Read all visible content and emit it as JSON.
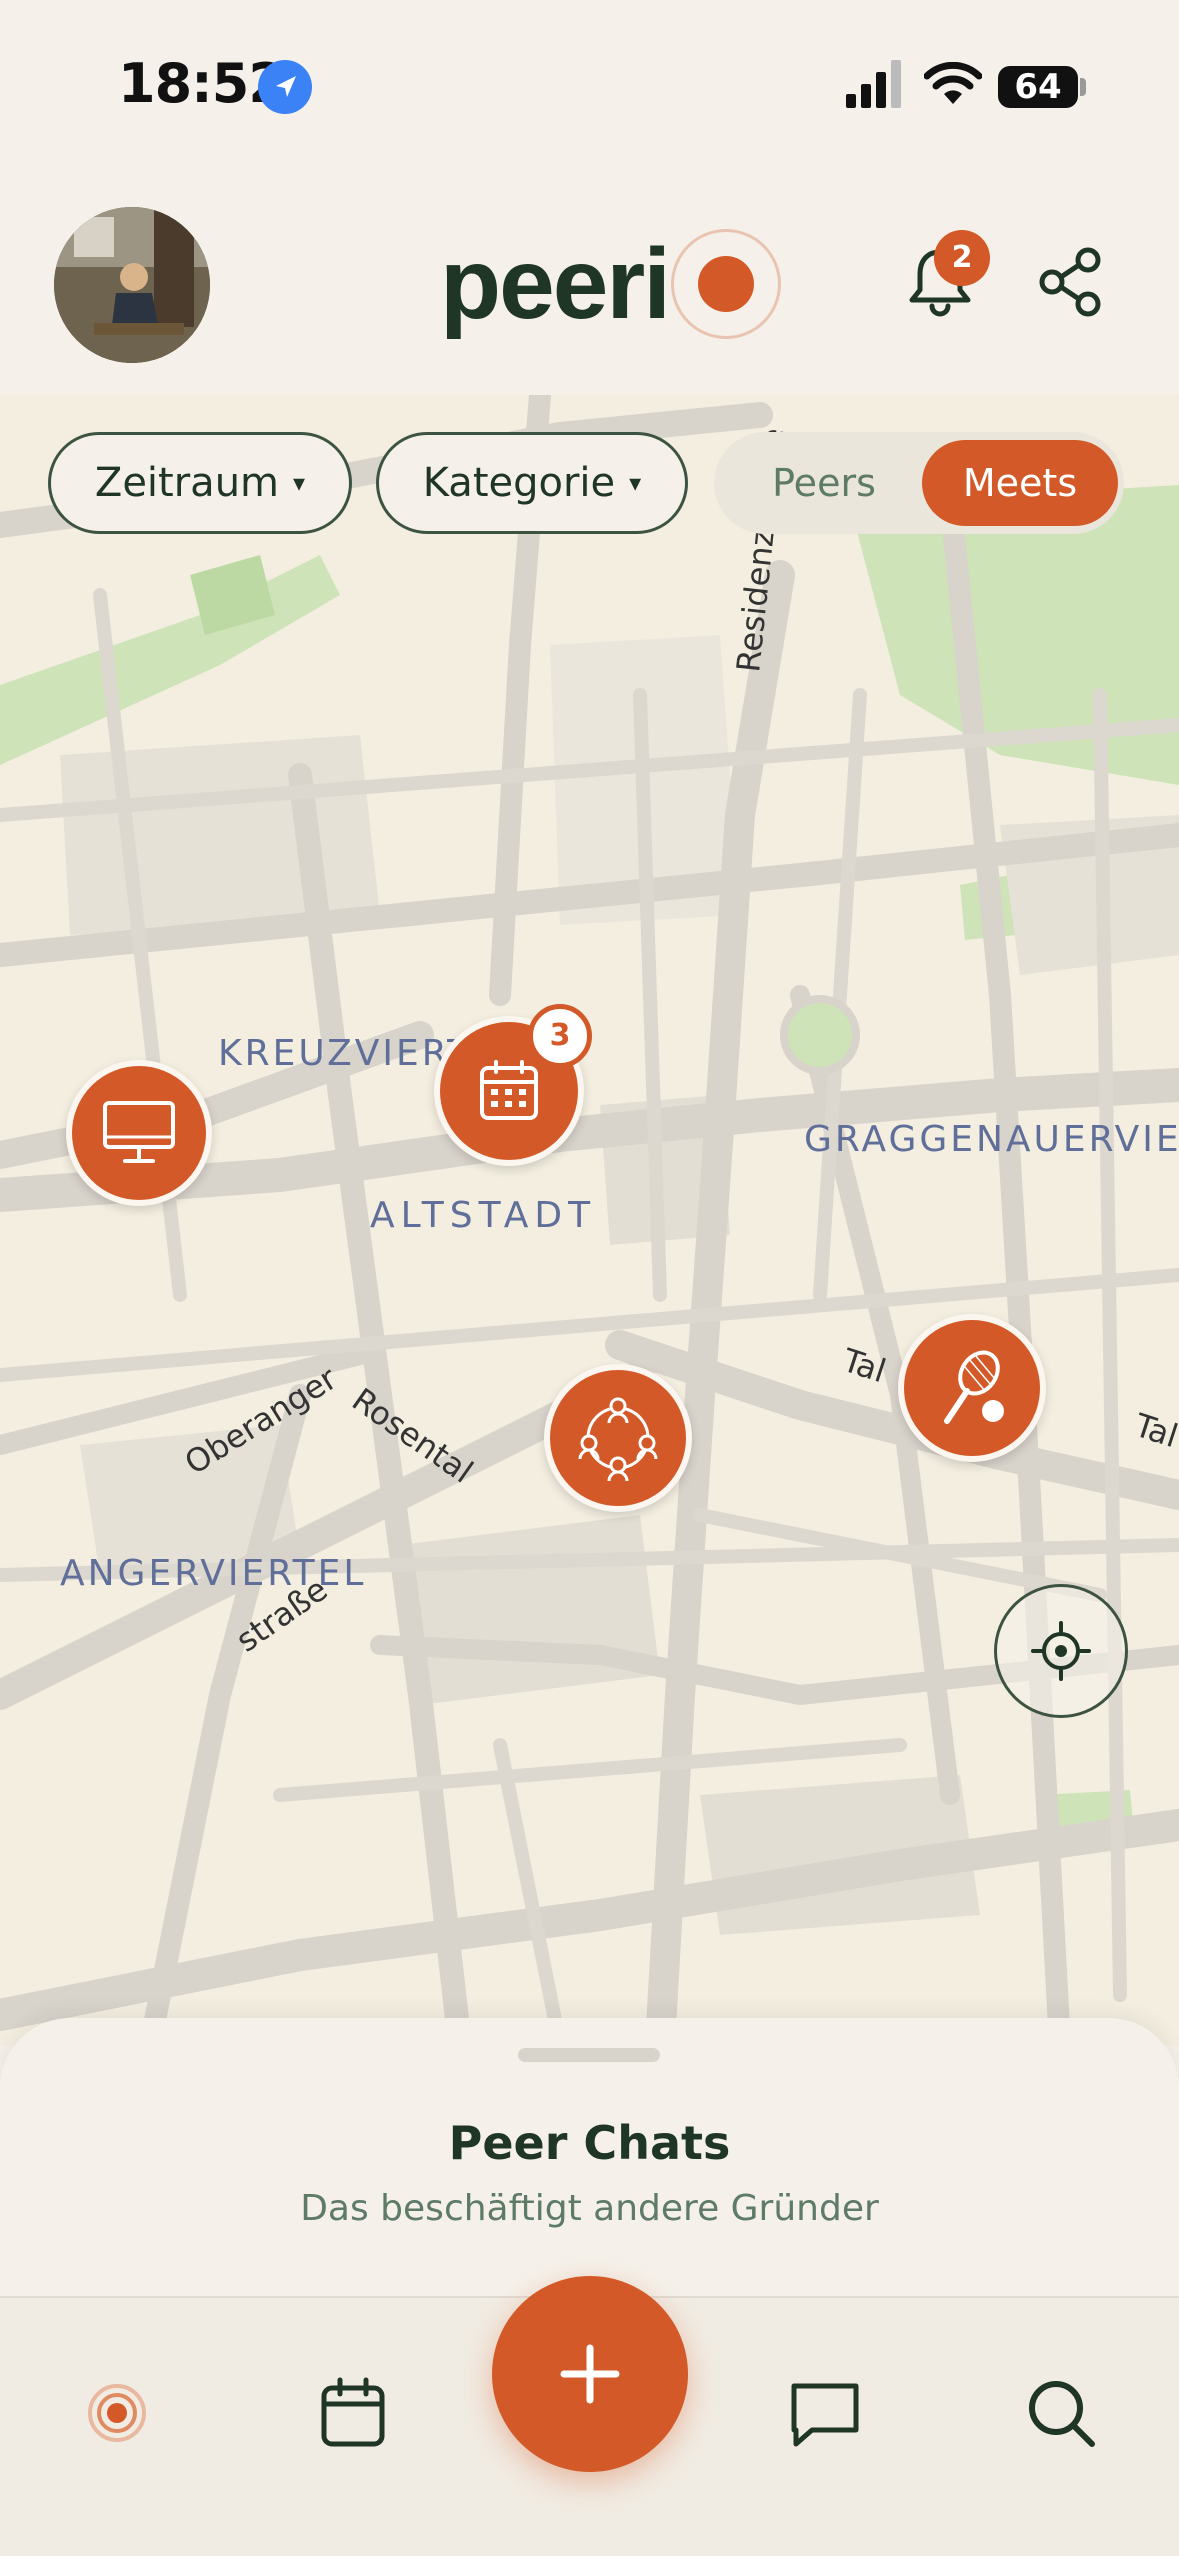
{
  "status_bar": {
    "time": "18:52",
    "battery": "64"
  },
  "header": {
    "logo_text": "peeri",
    "notification_count": "2",
    "icons": [
      "avatar",
      "bell-icon",
      "share-icon"
    ]
  },
  "filters": {
    "zeitraum_label": "Zeitraum",
    "kategorie_label": "Kategorie",
    "caret": "▾",
    "toggle": {
      "peers_label": "Peers",
      "meets_label": "Meets",
      "selected": "Meets"
    }
  },
  "map": {
    "district_labels": {
      "kreuzviertel": "KREUZVIERTEL",
      "graggenauerviertel": "GRAGGENAUERVIER",
      "altstadt": "ALTSTADT",
      "angerviertel": "ANGERVIERTEL"
    },
    "street_labels": {
      "residenzstrasse": "Residenzstraße",
      "tal": "Tal",
      "tal2": "Tal",
      "rosental": "Rosental",
      "oberanger": "Oberanger",
      "strasse": "straße"
    },
    "markers": [
      {
        "icon": "monitor-icon"
      },
      {
        "icon": "calendar-icon",
        "badge": "3"
      },
      {
        "icon": "group-icon"
      },
      {
        "icon": "tennis-icon"
      }
    ]
  },
  "sheet": {
    "title": "Peer Chats",
    "subtitle": "Das beschäftigt andere Gründer"
  },
  "tabbar": {
    "tabs": [
      "map-tab-icon",
      "calendar-tab-icon",
      "create-button",
      "chat-tab-icon",
      "search-tab-icon"
    ]
  },
  "colors": {
    "accent": "#d35a28",
    "dark_green": "#1f3526",
    "muted_green": "#5d7b66",
    "background": "#f5f1ea",
    "map_road": "#d8d3cb"
  }
}
